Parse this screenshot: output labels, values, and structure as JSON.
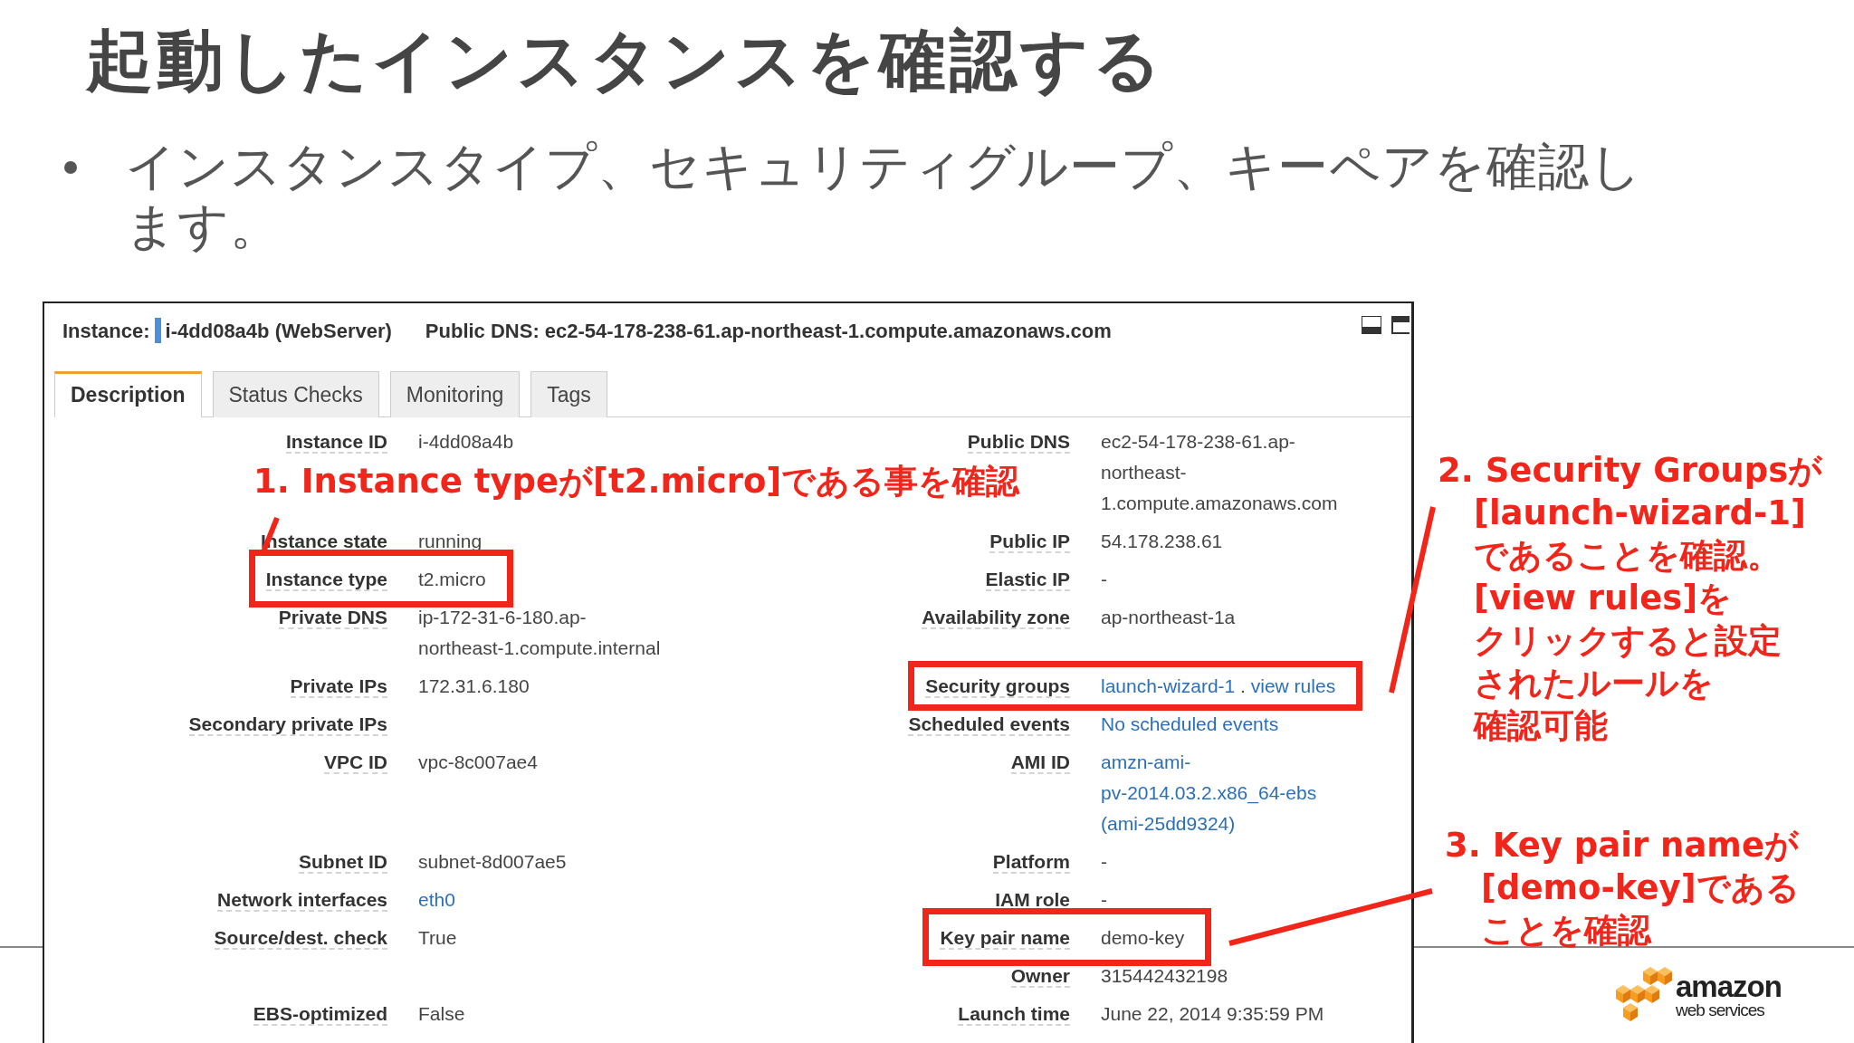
{
  "slide_title": "起動したインスタンスを確認する",
  "bullets": [
    "インスタンスタイプ、セキュリティグループ、キーペアを確認します。"
  ],
  "console": {
    "header": {
      "instance_label": "Instance:",
      "instance_value": "i-4dd08a4b (WebServer)",
      "dns_label": "Public DNS:",
      "dns_value": "ec2-54-178-238-61.ap-northeast-1.compute.amazonaws.com"
    },
    "tabs": [
      {
        "label": "Description",
        "selected": true
      },
      {
        "label": "Status Checks",
        "selected": false
      },
      {
        "label": "Monitoring",
        "selected": false
      },
      {
        "label": "Tags",
        "selected": false
      }
    ],
    "rows": [
      {
        "left": {
          "label": "Instance ID",
          "value": [
            "i-4dd08a4b"
          ]
        },
        "right": {
          "label": "Public DNS",
          "value": [
            "ec2-54-178-238-61.ap-",
            "northeast-",
            "1.compute.amazonaws.com"
          ]
        }
      },
      {
        "left": {
          "label": "Instance state",
          "value": [
            "running"
          ]
        },
        "right": {
          "label": "Public IP",
          "value": [
            "54.178.238.61"
          ]
        }
      },
      {
        "left": {
          "label": "Instance type",
          "value": [
            "t2.micro"
          ],
          "highlighted": true
        },
        "right": {
          "label": "Elastic IP",
          "value": [
            "-"
          ]
        }
      },
      {
        "left": {
          "label": "Private DNS",
          "value": [
            "ip-172-31-6-180.ap-",
            "northeast-1.compute.internal"
          ]
        },
        "right": {
          "label": "Availability zone",
          "value": [
            "ap-northeast-1a"
          ]
        }
      },
      {
        "left": {
          "label": "Private IPs",
          "value": [
            "172.31.6.180"
          ]
        },
        "right": {
          "label": "Security groups",
          "parts": [
            {
              "text": "launch-wizard-1",
              "link": true
            },
            {
              "text": ".",
              "link": false
            },
            {
              "text": "view rules",
              "link": true
            }
          ],
          "highlighted": true
        }
      },
      {
        "left": {
          "label": "Secondary private IPs"
        },
        "right": {
          "label": "Scheduled events",
          "value": [
            "No scheduled events"
          ],
          "link": true
        }
      },
      {
        "left": {
          "label": "VPC ID",
          "value": [
            "vpc-8c007ae4"
          ]
        },
        "right": {
          "label": "AMI ID",
          "value": [
            "amzn-ami-",
            "pv-2014.03.2.x86_64-ebs",
            "(ami-25dd9324)"
          ],
          "link": true
        }
      },
      {
        "left": {
          "label": "Subnet ID",
          "value": [
            "subnet-8d007ae5"
          ]
        },
        "right": {
          "label": "Platform",
          "value": [
            "-"
          ]
        }
      },
      {
        "left": {
          "label": "Network interfaces",
          "value": [
            "eth0"
          ],
          "link": true
        },
        "right": {
          "label": "IAM role",
          "value": [
            "-"
          ]
        }
      },
      {
        "left": {
          "label": "Source/dest. check",
          "value": [
            "True"
          ]
        },
        "right": {
          "label": "Key pair name",
          "value": [
            "demo-key"
          ],
          "highlighted": true
        }
      },
      {
        "right": {
          "label": "Owner",
          "value": [
            "315442432198"
          ]
        }
      },
      {
        "left": {
          "label": "EBS-optimized",
          "value": [
            "False"
          ]
        },
        "right": {
          "label": "Launch time",
          "value": [
            "June 22, 2014 9:35:59 PM"
          ]
        }
      }
    ]
  },
  "callouts": [
    {
      "lines": [
        "1. Instance typeが[t2.micro]である事を確認"
      ]
    },
    {
      "lines": [
        "2. Security Groupsが",
        "[launch-wizard-1]",
        "であることを確認。",
        "[view rules]を",
        "クリックすると設定",
        "されたルールを",
        "確認可能"
      ]
    },
    {
      "lines": [
        "3. Key pair nameが",
        "[demo-key]である",
        "ことを確認"
      ]
    }
  ],
  "logo": {
    "wordmark": "amazon",
    "tagline": "web services"
  }
}
